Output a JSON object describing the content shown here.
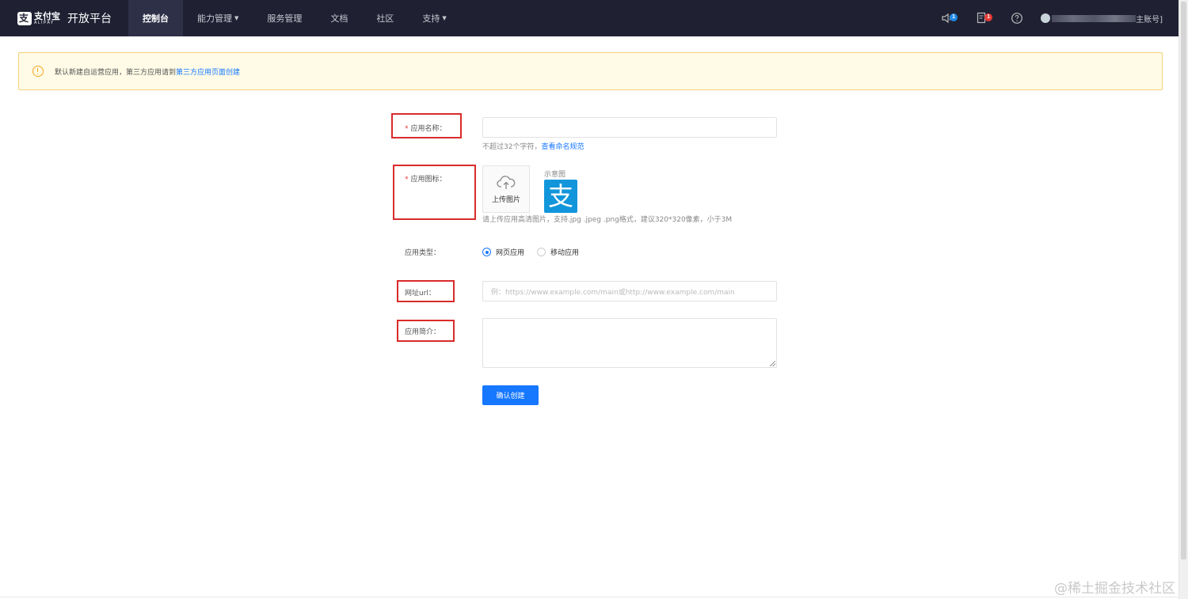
{
  "header": {
    "logo_cn": "支付宝",
    "logo_en": "ALIPAY",
    "platform_title": "开放平台",
    "nav": [
      {
        "label": "控制台",
        "active": true,
        "dropdown": false
      },
      {
        "label": "能力管理",
        "active": false,
        "dropdown": true
      },
      {
        "label": "服务管理",
        "active": false,
        "dropdown": false
      },
      {
        "label": "文档",
        "active": false,
        "dropdown": false
      },
      {
        "label": "社区",
        "active": false,
        "dropdown": false
      },
      {
        "label": "支持",
        "active": false,
        "dropdown": true
      }
    ],
    "notify_badge": "1",
    "todo_badge": "1",
    "account_suffix": "主账号]"
  },
  "alert": {
    "text": "默认新建自运营应用，第三方应用请到",
    "link": "第三方应用页面创建"
  },
  "form": {
    "name_label": "应用名称：",
    "name_help": "不超过32个字符，",
    "name_help_link": "查看命名规范",
    "icon_label": "应用图标：",
    "upload_label": "上传图片",
    "sample_label": "示意图",
    "sample_glyph": "支",
    "icon_help": "请上传应用高清图片，支持.jpg .jpeg .png格式，建议320*320像素，小于3M",
    "type_label": "应用类型：",
    "type_options": [
      "网页应用",
      "移动应用"
    ],
    "url_label": "网址url：",
    "url_placeholder": "例：https://www.example.com/main或http://www.example.com/main",
    "intro_label": "应用简介：",
    "submit_label": "确认创建"
  },
  "watermark": "@稀土掘金技术社区",
  "colors": {
    "nav_bg": "#1f2133",
    "primary": "#1677ff",
    "alert_bg": "#fffbe6",
    "annotation_red": "#d92b2b"
  }
}
